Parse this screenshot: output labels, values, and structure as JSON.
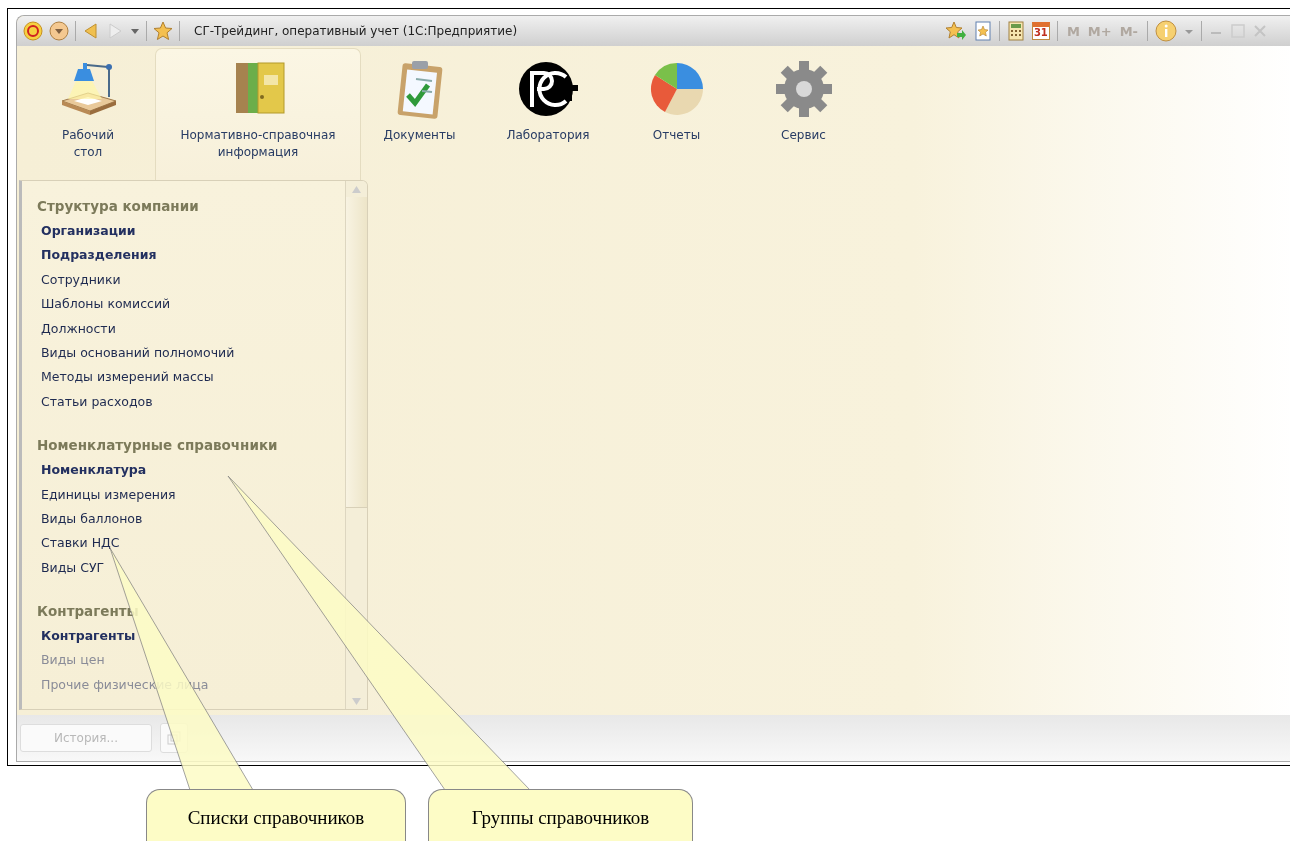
{
  "window": {
    "title": "СГ-Трейдинг, оперативный учет  (1С:Предприятие)"
  },
  "toolbar_right": {
    "calendar_day": "31",
    "memory_buttons": [
      "M",
      "M+",
      "M-"
    ]
  },
  "sections": [
    {
      "label": "Рабочий\nстол",
      "selected": false
    },
    {
      "label": "Нормативно-справочная\nинформация",
      "selected": true
    },
    {
      "label": "Документы",
      "selected": false
    },
    {
      "label": "Лаборатория",
      "selected": false
    },
    {
      "label": "Отчеты",
      "selected": false
    },
    {
      "label": "Сервис",
      "selected": false
    }
  ],
  "nav_groups": [
    {
      "title": "Структура компании",
      "items": [
        {
          "label": "Организации",
          "kind": "main"
        },
        {
          "label": "Подразделения",
          "kind": "main"
        },
        {
          "label": "Сотрудники",
          "kind": "normal"
        },
        {
          "label": "Шаблоны комиссий",
          "kind": "normal"
        },
        {
          "label": "Должности",
          "kind": "normal"
        },
        {
          "label": "Виды оснований полномочий",
          "kind": "normal"
        },
        {
          "label": "Методы измерений массы",
          "kind": "normal"
        },
        {
          "label": "Статьи расходов",
          "kind": "normal"
        }
      ]
    },
    {
      "title": "Номенклатурные справочники",
      "items": [
        {
          "label": "Номенклатура",
          "kind": "main"
        },
        {
          "label": "Единицы измерения",
          "kind": "normal"
        },
        {
          "label": "Виды баллонов",
          "kind": "normal"
        },
        {
          "label": "Ставки НДС",
          "kind": "normal"
        },
        {
          "label": "Виды СУГ",
          "kind": "normal"
        }
      ]
    },
    {
      "title": "Контрагенты",
      "items": [
        {
          "label": "Контрагенты",
          "kind": "main"
        },
        {
          "label": "Виды цен",
          "kind": "faded"
        },
        {
          "label": "Прочие физические лица",
          "kind": "faded"
        }
      ]
    }
  ],
  "bottom_bar": {
    "history_button": {
      "label": "История...",
      "disabled": true
    }
  },
  "callouts": [
    {
      "text": "Списки справочников"
    },
    {
      "text": "Группы справочников"
    }
  ]
}
